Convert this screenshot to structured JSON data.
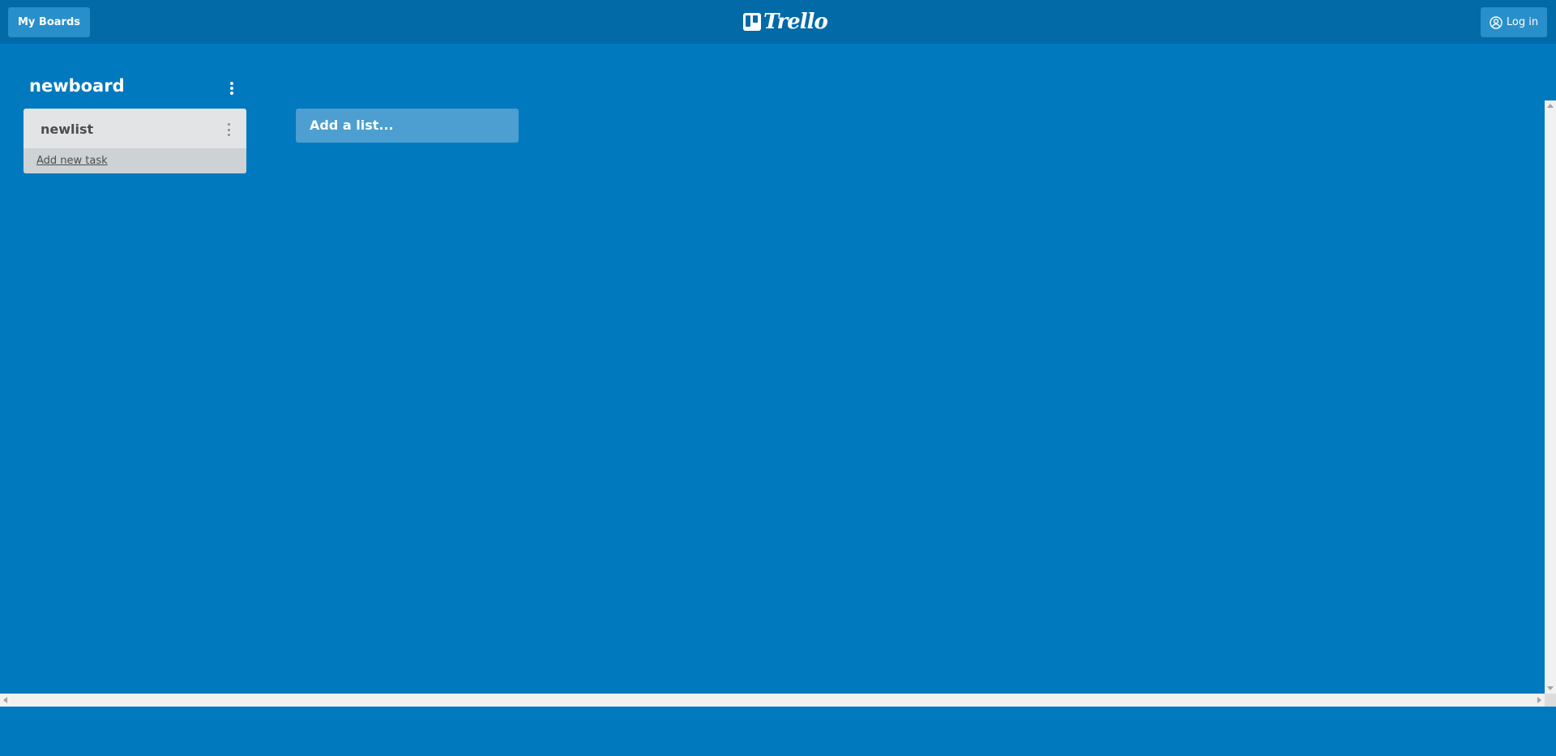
{
  "header": {
    "my_boards_label": "My Boards",
    "logo_text": "Trello",
    "login_label": "Log in"
  },
  "board": {
    "title": "newboard",
    "lists": [
      {
        "title": "newlist",
        "add_task_label": "Add new task"
      }
    ],
    "add_list_placeholder": "Add a list..."
  },
  "colors": {
    "background": "#0079bf",
    "header": "#026aa7",
    "header_button": "#298fca",
    "list_bg": "#e2e4e6",
    "list_footer_bg": "#cdd2d4"
  },
  "icons": {
    "login": "user-circle-icon",
    "board_menu": "more-vertical-icon",
    "list_menu": "more-vertical-icon"
  }
}
